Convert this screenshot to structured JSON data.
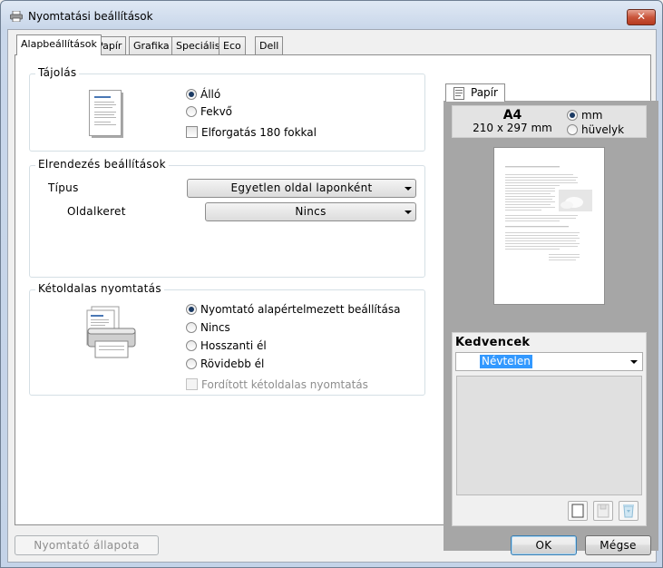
{
  "window": {
    "title": "Nyomtatási beállítások",
    "close_glyph": "✕"
  },
  "tabs": [
    {
      "label": "Alapbeállítások",
      "active": true
    },
    {
      "label": "Papír"
    },
    {
      "label": "Grafika"
    },
    {
      "label": "Speciális"
    },
    {
      "label": "Eco"
    },
    {
      "label": "Dell"
    }
  ],
  "orientation": {
    "title": "Tájolás",
    "options": [
      "Álló",
      "Fekvő"
    ],
    "selected": "Álló",
    "rotate_label": "Elforgatás 180 fokkal",
    "rotate_checked": false
  },
  "layout": {
    "title": "Elrendezés beállítások",
    "type_label": "Típus",
    "type_value": "Egyetlen oldal laponként",
    "border_label": "Oldalkeret",
    "border_value": "Nincs"
  },
  "duplex": {
    "title": "Kétoldalas nyomtatás",
    "options": [
      "Nyomtató alapértelmezett beállítása",
      "Nincs",
      "Hosszanti él",
      "Rövidebb él"
    ],
    "selected": "Nyomtató alapértelmezett beállítása",
    "reverse_label": "Fordított kétoldalas nyomtatás",
    "reverse_enabled": false
  },
  "preview": {
    "tab_label": "Papír",
    "paper_size": "A4",
    "paper_dims": "210 x 297 mm",
    "units": [
      "mm",
      "hüvelyk"
    ],
    "selected_unit": "mm"
  },
  "favorites": {
    "title": "Kedvencek",
    "selected": "Névtelen"
  },
  "footer": {
    "status_button": "Nyomtató állapota",
    "ok_button": "OK",
    "cancel_button": "Mégse"
  },
  "colors": {
    "accent": "#3c7fb1",
    "selection": "#3399ff",
    "preview_bg": "#a6a6a6"
  }
}
